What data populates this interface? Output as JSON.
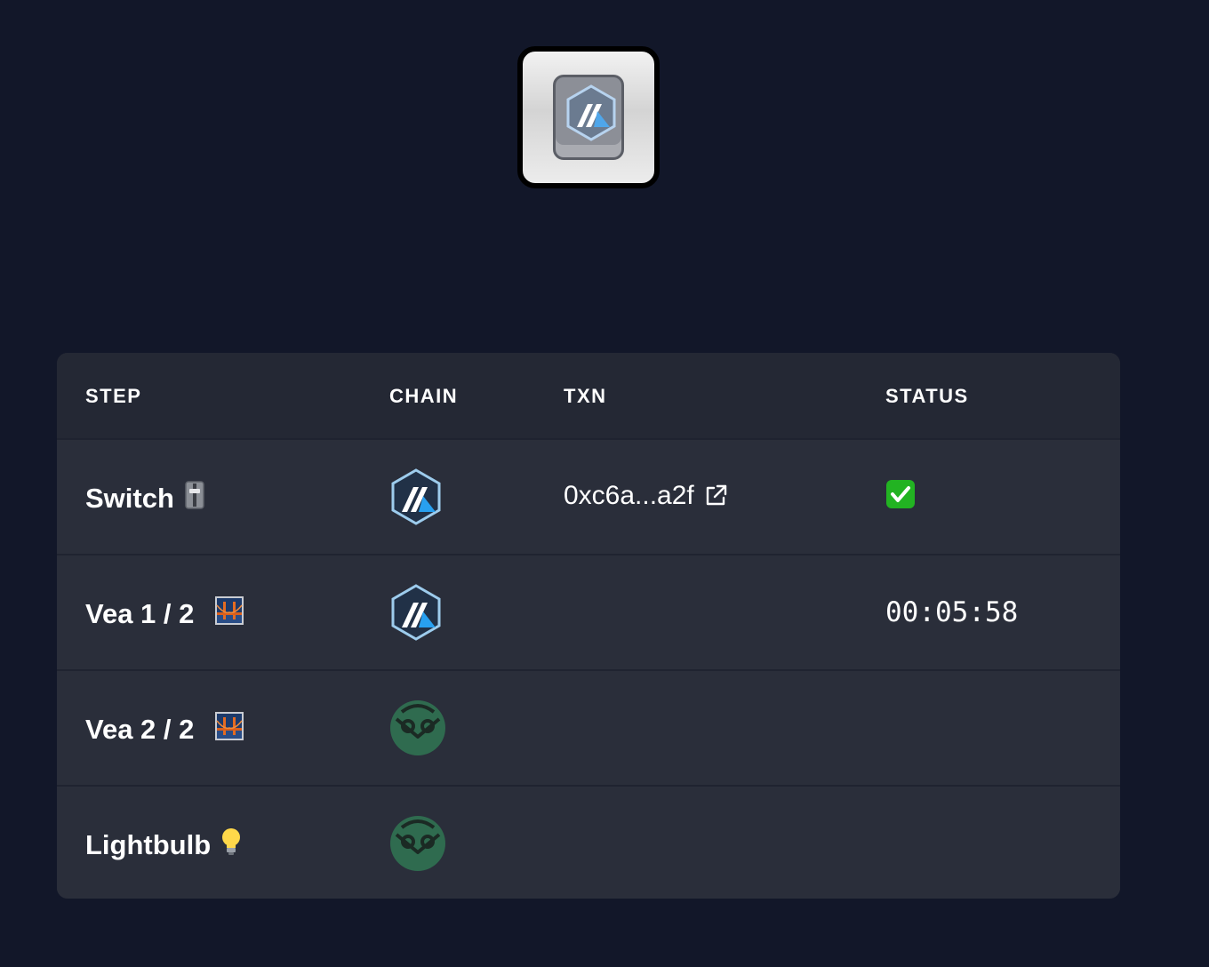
{
  "header_button": {
    "icon": "arbitrum-key-icon"
  },
  "table": {
    "columns": [
      "STEP",
      "CHAIN",
      "TXN",
      "STATUS"
    ],
    "rows": [
      {
        "step": "Switch",
        "step_icon": "switch-emoji-icon",
        "chain": "arbitrum",
        "txn": "0xc6a...a2f",
        "status": "check"
      },
      {
        "step": "Vea 1 / 2",
        "step_icon": "bridge-emoji-icon",
        "chain": "arbitrum",
        "txn": "",
        "status": "00:05:58"
      },
      {
        "step": "Vea 2 / 2",
        "step_icon": "bridge-emoji-icon",
        "chain": "gnosis",
        "txn": "",
        "status": ""
      },
      {
        "step": "Lightbulb",
        "step_icon": "lightbulb-emoji-icon",
        "chain": "gnosis",
        "txn": "",
        "status": ""
      }
    ]
  },
  "colors": {
    "background": "#121729",
    "panel": "#2a2e3a",
    "header": "#242834",
    "arbitrum_blue": "#28a0f0",
    "gnosis_green": "#2f6b4f",
    "check_green": "#22b322"
  }
}
